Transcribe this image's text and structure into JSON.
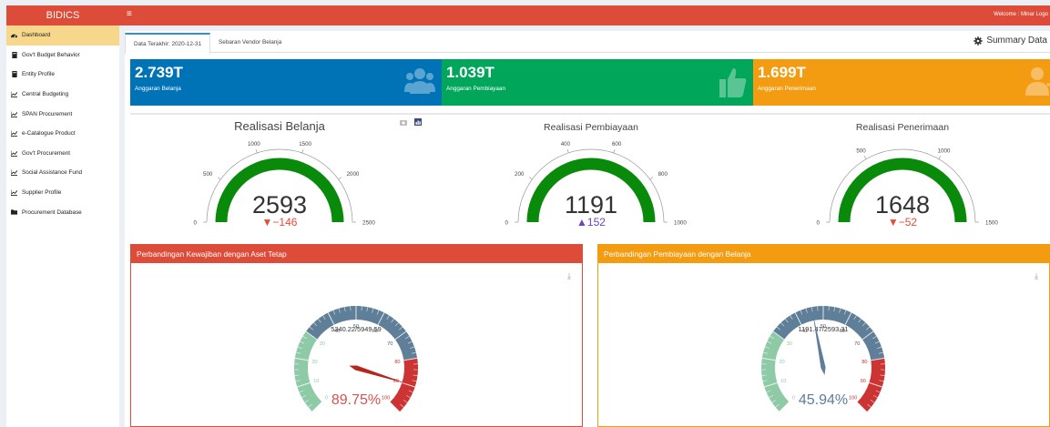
{
  "brand": "BIDICS",
  "header": {
    "menu_icon": "bars-icon",
    "welcome": "Welcome : Minar   Logo"
  },
  "sidebar": {
    "items": [
      {
        "label": "Dashboard",
        "icon": "dashboard-icon",
        "active": true
      },
      {
        "label": "Gov't Budget Behavior",
        "icon": "book-icon"
      },
      {
        "label": "Entity Profile",
        "icon": "book-icon"
      },
      {
        "label": "Central Budgeting",
        "icon": "chart-icon"
      },
      {
        "label": "SPAN Procurement",
        "icon": "chart-icon"
      },
      {
        "label": "e-Catalogue Product",
        "icon": "chart-icon"
      },
      {
        "label": "Gov't Procurement",
        "icon": "chart-icon"
      },
      {
        "label": "Social Assistance Fund",
        "icon": "chart-icon"
      },
      {
        "label": "Supplier Profile",
        "icon": "chart-icon"
      },
      {
        "label": "Procurement Database",
        "icon": "folder-icon"
      }
    ]
  },
  "tabs": [
    {
      "label": "Data Terakhir: 2020-12-31",
      "active": true
    },
    {
      "label": "Sebaran Vendor Belanja",
      "active": false
    }
  ],
  "summary_label": "Summary Data",
  "info_boxes": [
    {
      "value": "2.739T",
      "label": "Anggaran Belanja",
      "color": "#0073b7",
      "icon": "users-icon"
    },
    {
      "value": "1.039T",
      "label": "Anggaran Pembiayaan",
      "color": "#00a65a",
      "icon": "thumbs-up-icon"
    },
    {
      "value": "1.699T",
      "label": "Anggaran Penerimaan",
      "color": "#f39c12",
      "icon": "user-plus-icon"
    }
  ],
  "chart_data": [
    {
      "type": "gauge",
      "title": "Realisasi Belanja",
      "value": 2593,
      "delta": "▼−146",
      "delta_color": "#e74c3c",
      "range": [
        0,
        2500
      ],
      "ticks": [
        "0",
        "500",
        "1000",
        "1500",
        "2000",
        "2500"
      ],
      "toolbar_icons": [
        "camera-icon",
        "bar-chart-icon"
      ]
    },
    {
      "type": "gauge",
      "title": "Realisasi Pembiayaan",
      "value": 1191,
      "delta": "▲152",
      "delta_color": "#6f42c1",
      "range": [
        0,
        1000
      ],
      "ticks": [
        "0",
        "200",
        "400",
        "600",
        "800",
        "1000"
      ]
    },
    {
      "type": "gauge",
      "title": "Realisasi Penerimaan",
      "value": 1648,
      "delta": "▼−52",
      "delta_color": "#e74c3c",
      "range": [
        0,
        1500
      ],
      "ticks": [
        "0",
        "500",
        "1000",
        "1500"
      ]
    },
    {
      "type": "dial",
      "title": "Perbandingan Kewajiban dengan Aset Tetap",
      "header_color": "#dd4b39",
      "ratio": "5340.22/5949.59",
      "percent_label": "89.75%",
      "value": 89.75,
      "percent_color": "#d9534f",
      "range": [
        0,
        100
      ],
      "ticks": [
        "0",
        "10",
        "20",
        "30",
        "40",
        "50",
        "60",
        "70",
        "80",
        "90",
        "100"
      ],
      "icon": "download-icon"
    },
    {
      "type": "dial",
      "title": "Perbandingan Pembiayaan dengan Belanja",
      "header_color": "#f39c12",
      "ratio": "1191.47/2593.31",
      "percent_label": "45.94%",
      "value": 45.94,
      "percent_color": "#5a7d9a",
      "range": [
        0,
        100
      ],
      "ticks": [
        "0",
        "10",
        "20",
        "30",
        "40",
        "50",
        "60",
        "70",
        "80",
        "90",
        "100"
      ],
      "icon": "download-icon"
    }
  ]
}
